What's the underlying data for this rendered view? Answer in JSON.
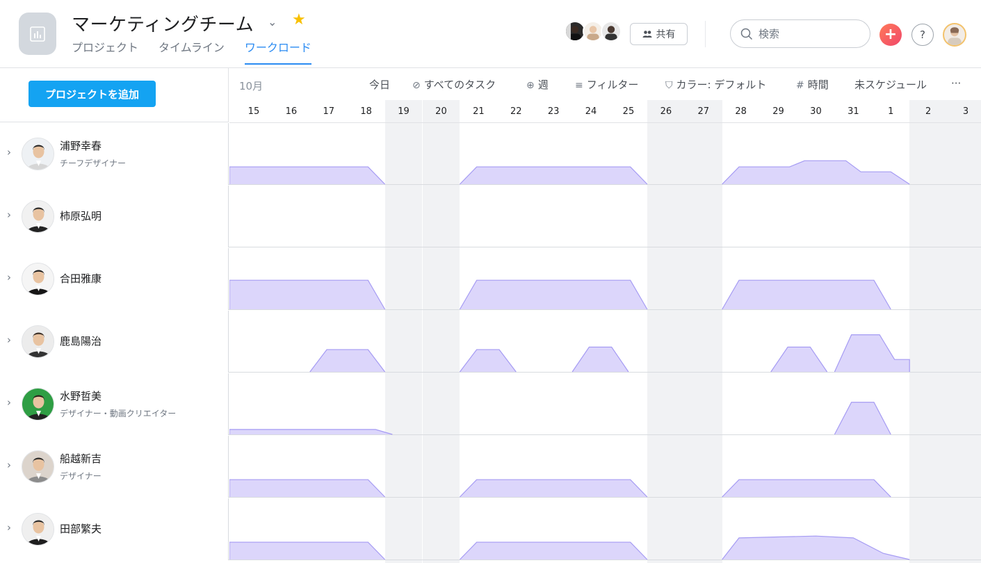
{
  "header": {
    "title": "マーケティングチーム",
    "tabs": [
      {
        "label": "プロジェクト",
        "active": false
      },
      {
        "label": "タイムライン",
        "active": false
      },
      {
        "label": "ワークロード",
        "active": true
      }
    ],
    "share_label": "共有",
    "search_placeholder": "検索",
    "add_symbol": "+",
    "help_symbol": "?"
  },
  "sidebar": {
    "add_project_label": "プロジェクトを追加"
  },
  "toolbar": {
    "month": "10月",
    "today": "今日",
    "all_tasks": "すべてのタスク",
    "week": "週",
    "filter": "フィルター",
    "color": "カラー: デフォルト",
    "hours": "時間",
    "unscheduled": "未スケジュール",
    "more": "···"
  },
  "dates": [
    "15",
    "16",
    "17",
    "18",
    "19",
    "20",
    "21",
    "22",
    "23",
    "24",
    "25",
    "26",
    "27",
    "28",
    "29",
    "30",
    "31",
    "1",
    "2",
    "3"
  ],
  "weekend_indices": [
    4,
    5,
    11,
    12,
    18,
    19
  ],
  "colors": {
    "accent": "#2a8bf2",
    "workload_fill": "#dcd6fb",
    "workload_line": "#a59bf3",
    "weekend": "#f1f2f4",
    "add_button": "#14a3f2"
  },
  "people": [
    {
      "name": "浦野幸春",
      "role": "チーフデザイナー",
      "avatar_icon": "person-avatar-icon",
      "workload": [
        {
          "from": 0,
          "to": 4,
          "peak": 0.28
        },
        {
          "from": 6,
          "to": 11,
          "peak": 0.28
        },
        {
          "from": 13,
          "to": 18,
          "peak": 0.28,
          "steps": [
            [
              14.8,
              0.28
            ],
            [
              15.2,
              0.38
            ],
            [
              16.3,
              0.38
            ],
            [
              16.7,
              0.2
            ],
            [
              17.5,
              0.2
            ]
          ]
        }
      ]
    },
    {
      "name": "柿原弘明",
      "role": "",
      "avatar_icon": "person-avatar-icon",
      "workload": []
    },
    {
      "name": "合田雅康",
      "role": "",
      "avatar_icon": "person-avatar-icon",
      "workload": [
        {
          "from": 0,
          "to": 4,
          "peak": 0.47
        },
        {
          "from": 6,
          "to": 11,
          "peak": 0.47
        },
        {
          "from": 13,
          "to": 17.5,
          "peak": 0.47
        }
      ]
    },
    {
      "name": "鹿島陽治",
      "role": "",
      "avatar_icon": "person-avatar-icon",
      "workload": [
        {
          "from": 2,
          "to": 4,
          "peak": 0.36
        },
        {
          "from": 6,
          "to": 7.5,
          "peak": 0.36
        },
        {
          "from": 9,
          "to": 10.5,
          "peak": 0.4
        },
        {
          "from": 14.3,
          "to": 15.8,
          "peak": 0.4
        },
        {
          "from": 16,
          "to": 18,
          "peak": 0.6,
          "steps": [
            [
              16.8,
              0.6
            ],
            [
              17.2,
              0.6
            ],
            [
              17.6,
              0.2
            ],
            [
              18,
              0.2
            ]
          ]
        }
      ]
    },
    {
      "name": "水野哲美",
      "role": "デザイナー・動画クリエイター",
      "avatar_icon": "person-avatar-icon",
      "workload": [
        {
          "from": 0,
          "to": 4.2,
          "peak": 0.08
        },
        {
          "from": 16,
          "to": 17.5,
          "peak": 0.52
        }
      ]
    },
    {
      "name": "船越新吉",
      "role": "デザイナー",
      "avatar_icon": "person-avatar-icon",
      "workload": [
        {
          "from": 0,
          "to": 4,
          "peak": 0.28
        },
        {
          "from": 6,
          "to": 11,
          "peak": 0.28
        },
        {
          "from": 13,
          "to": 17.5,
          "peak": 0.28
        }
      ]
    },
    {
      "name": "田部繁夫",
      "role": "",
      "avatar_icon": "person-avatar-icon",
      "workload": [
        {
          "from": 0,
          "to": 4,
          "peak": 0.28
        },
        {
          "from": 6,
          "to": 11,
          "peak": 0.28
        },
        {
          "from": 13,
          "to": 18,
          "peak": 0.35,
          "steps": [
            [
              15.5,
              0.38
            ],
            [
              16.5,
              0.35
            ],
            [
              17.3,
              0.1
            ],
            [
              18,
              0
            ]
          ]
        }
      ]
    }
  ]
}
